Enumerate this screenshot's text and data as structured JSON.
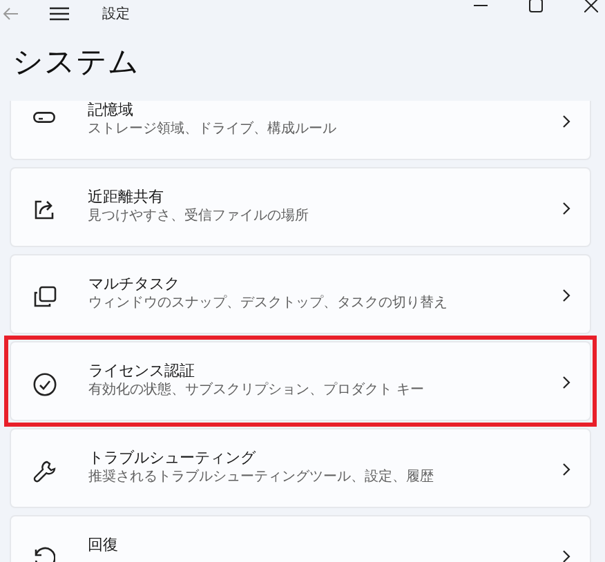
{
  "window": {
    "title": "設定"
  },
  "page_title": "システム",
  "items": [
    {
      "title": "記憶域",
      "subtitle": "ストレージ領域、ドライブ、構成ルール",
      "highlighted": false
    },
    {
      "title": "近距離共有",
      "subtitle": "見つけやすさ、受信ファイルの場所",
      "highlighted": false
    },
    {
      "title": "マルチタスク",
      "subtitle": "ウィンドウのスナップ、デスクトップ、タスクの切り替え",
      "highlighted": false
    },
    {
      "title": "ライセンス認証",
      "subtitle": "有効化の状態、サブスクリプション、プロダクト キー",
      "highlighted": true
    },
    {
      "title": "トラブルシューティング",
      "subtitle": "推奨されるトラブルシューティングツール、設定、履歴",
      "highlighted": false
    },
    {
      "title": "回復",
      "highlighted": false
    }
  ]
}
